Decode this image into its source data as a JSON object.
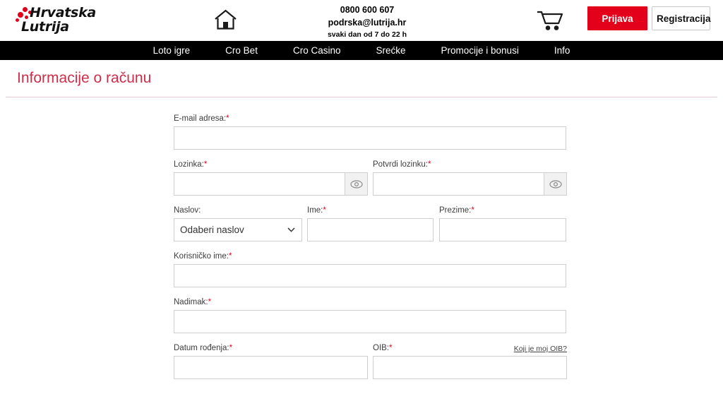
{
  "brand": {
    "name_line1": "Hrvatska",
    "name_line2": "Lutrija",
    "red": "#e2001a",
    "title_red": "#cf2e4a"
  },
  "header": {
    "home_icon": "home-icon",
    "cart_icon": "cart-icon",
    "contact": {
      "phone": "0800 600 607",
      "email": "podrska@lutrija.hr",
      "hours": "svaki dan od 7 do 22 h"
    },
    "login_label": "Prijava",
    "register_label": "Registracija"
  },
  "nav": {
    "items": [
      {
        "label": "Loto igre"
      },
      {
        "label": "Cro Bet"
      },
      {
        "label": "Cro Casino"
      },
      {
        "label": "Srećke"
      },
      {
        "label": "Promocije i bonusi"
      },
      {
        "label": "Info"
      }
    ]
  },
  "page": {
    "title": "Informacije o računu"
  },
  "form": {
    "email": {
      "label": "E-mail adresa:",
      "required": "*",
      "value": "",
      "placeholder": ""
    },
    "password": {
      "label": "Lozinka:",
      "required": "*",
      "value": "",
      "placeholder": "",
      "toggle_icon": "eye-icon"
    },
    "password_confirm": {
      "label": "Potvrdi lozinku:",
      "required": "*",
      "value": "",
      "placeholder": "",
      "toggle_icon": "eye-icon"
    },
    "title_select": {
      "label": "Naslov:",
      "required": "",
      "selected": "Odaberi naslov",
      "options": [
        "Odaberi naslov"
      ],
      "chevron_icon": "chevron-down-icon"
    },
    "first_name": {
      "label": "Ime:",
      "required": "*",
      "value": "",
      "placeholder": ""
    },
    "last_name": {
      "label": "Prezime:",
      "required": "*",
      "value": "",
      "placeholder": ""
    },
    "username": {
      "label": "Korisničko ime:",
      "required": "*",
      "value": "",
      "placeholder": ""
    },
    "nickname": {
      "label": "Nadimak:",
      "required": "*",
      "value": "",
      "placeholder": ""
    },
    "birth_date": {
      "label": "Datum rođenja:",
      "required": "*",
      "value": "",
      "placeholder": ""
    },
    "oib": {
      "label": "OIB:",
      "required": "*",
      "value": "",
      "placeholder": "",
      "help_link": "Koji je moj OIB?"
    }
  }
}
